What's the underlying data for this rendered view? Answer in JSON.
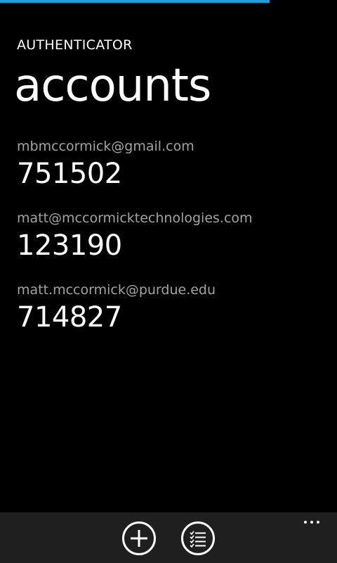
{
  "app": {
    "title": "AUTHENTICATOR",
    "page_title": "accounts"
  },
  "progress": {
    "fraction_remaining": 0.8,
    "color": "#1ba1e2"
  },
  "accounts": [
    {
      "email": "mbmccormick@gmail.com",
      "code": "751502"
    },
    {
      "email": "matt@mccormicktechnologies.com",
      "code": "123190"
    },
    {
      "email": "matt.mccormick@purdue.edu",
      "code": "714827"
    }
  ],
  "app_bar": {
    "buttons": [
      {
        "name": "add-account-button",
        "icon": "plus-icon"
      },
      {
        "name": "select-accounts-button",
        "icon": "checklist-icon"
      }
    ],
    "more_icon": "ellipsis-icon",
    "background": "#1f1f1f"
  },
  "colors": {
    "background": "#000000",
    "accent": "#1ba1e2",
    "secondary_text": "#a3a3a3"
  }
}
